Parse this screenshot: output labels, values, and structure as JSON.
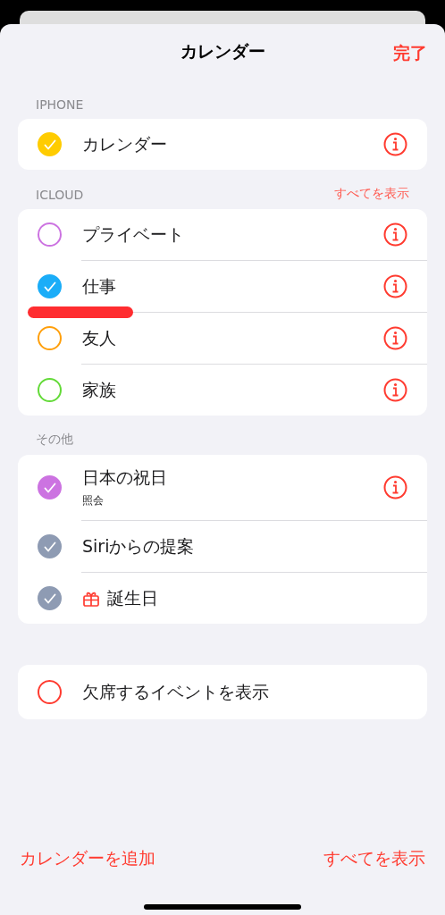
{
  "header": {
    "title": "カレンダー",
    "done": "完了"
  },
  "sections": [
    {
      "title": "IPHONE",
      "items": [
        {
          "kind": "calendar",
          "name": "カレンダー",
          "color": "#ffcc00",
          "checked": true,
          "info": true
        }
      ]
    },
    {
      "title": "ICLOUD",
      "action": "すべてを表示",
      "items": [
        {
          "kind": "calendar",
          "name": "プライベート",
          "color": "#cc73e1",
          "checked": false,
          "info": true
        },
        {
          "kind": "calendar",
          "name": "仕事",
          "color": "#1badf8",
          "checked": true,
          "info": true
        },
        {
          "kind": "calendar",
          "name": "友人",
          "color": "#ff9f0a",
          "checked": false,
          "info": true
        },
        {
          "kind": "calendar",
          "name": "家族",
          "color": "#63da38",
          "checked": false,
          "info": true
        }
      ]
    },
    {
      "title": "その他",
      "items": [
        {
          "kind": "calendar",
          "name": "日本の祝日",
          "subtitle": "照会",
          "color": "#cc73e1",
          "checked": true,
          "info": true
        },
        {
          "kind": "calendar",
          "name": "Siriからの提案",
          "color": "#8e9bb3",
          "checked": true,
          "info": false
        },
        {
          "kind": "birthday",
          "name": "誕生日",
          "color": "#8e9bb3",
          "checked": true,
          "info": false
        }
      ]
    },
    {
      "items": [
        {
          "kind": "calendar",
          "name": "欠席するイベントを表示",
          "color": "#ff3b30",
          "checked": false,
          "info": false
        }
      ]
    }
  ],
  "footer": {
    "add": "カレンダーを追加",
    "show_all": "すべてを表示"
  }
}
